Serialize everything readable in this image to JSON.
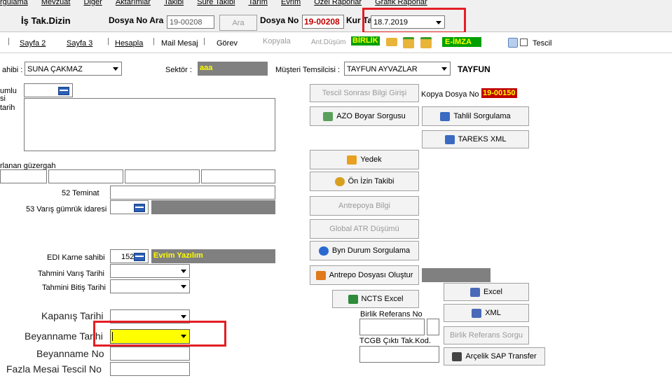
{
  "menu": {
    "items": [
      "rgulama",
      "Mevzuat",
      "Diğer",
      "Aktarımlar",
      "Takibi",
      "Süre Takibi",
      "Tarım",
      "Evrim",
      "Özel Raporlar",
      "Grafik Raporlar"
    ]
  },
  "header": {
    "title": "İş Tak.Dizin",
    "dosya_ara_label": "Dosya No Ara",
    "dosya_ara_value": "19-00208",
    "ara_button": "Ara",
    "dosya_no_label": "Dosya No",
    "dosya_no_value": "19-00208",
    "kur_tar_label": "Kur Tar",
    "kur_tar_value": "18.7.2019"
  },
  "toolbar": {
    "sayfa2": "Sayfa 2",
    "sayfa3": "Sayfa 3",
    "hesapla": "Hesapla",
    "mail_mesaj": "Mail Mesaj",
    "gorev": "Görev",
    "kopyala": "Kopyala",
    "ant_dusum": "Ant.Düşüm",
    "birlik": "BİRLİK",
    "e_imza": "E-İMZA",
    "tescil": "Tescil"
  },
  "owner_row": {
    "sahibi_label": "ahibi :",
    "sahibi_value": "SUNA ÇAKMAZ",
    "sektor_label": "Sektör :",
    "sektor_value": "aaa",
    "musteri_label": "Müşteri Temsilcisi :",
    "musteri_value": "TAYFUN AYVAZLAR",
    "musteri_short": "TAYFUN"
  },
  "left": {
    "sorumlu_label": "umlu",
    "si_label": "si",
    "tarih_label": "tarih",
    "guzergah_label": "rlanan güzergah",
    "teminat_label": "52 Teminat",
    "varis_gumruk_label": "53 Varış gümrük idaresi",
    "edi_label": "EDI Karne sahibi",
    "edi_value": "152",
    "edi_name": "Evrim Yazılım",
    "tahmini_varis_label": "Tahmini Varış Tarihi",
    "tahmini_bitis_label": "Tahmini Bitiş Tarihi",
    "kapanis_label": "Kapanış Tarihi",
    "beyanname_tarihi_label": "Beyanname Tarihi",
    "beyanname_no_label": "Beyanname No",
    "fazla_mesai_label": "Fazla Mesai Tescil No"
  },
  "right": {
    "tescil_sonrasi": "Tescil Sonrası Bilgi Girişi",
    "kopya_dosya_label": "Kopya Dosya No",
    "kopya_dosya_value": "19-00150",
    "azo_boyar": "AZO Boyar Sorgusu",
    "tahlil": "Tahlil Sorgulama",
    "tareks": "TAREKS XML",
    "yedek": "Yedek",
    "on_izin": "Ön İzin Takibi",
    "antrepoya": "Antrepoya Bilgi",
    "global_atr": "Global ATR Düşümü",
    "byn_durum": "Byn Durum Sorgulama",
    "antrepo_dosyasi": "Antrepo Dosyası Oluştur",
    "ncts_excel": "NCTS Excel",
    "excel": "Excel",
    "xml": "XML",
    "birlik_ref_label": "Birlik Referans No",
    "birlik_ref_sorgu": "Birlik Referans Sorgu",
    "tcgb_label": "TCGB Çıktı Tak.Kod.",
    "arcelik": "Arçelik SAP Transfer"
  },
  "colors": {
    "highlight_yellow": "#ffff00",
    "red_annotation": "#e31e24",
    "dosya_red": "#c00000",
    "birlik_bg": "#00a000",
    "gray_field": "#808080"
  }
}
